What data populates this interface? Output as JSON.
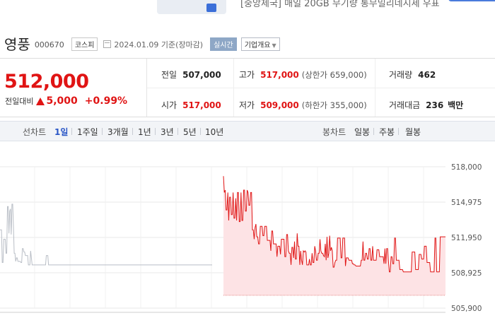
{
  "ad": {
    "text": "[중앙제국] 매일 20GB 무기량 통무밀리네시세 우표"
  },
  "stock": {
    "name": "영풍",
    "code": "000670",
    "market": "코스피",
    "date": "2024.01.09",
    "basis": "기준(장마감)",
    "realtime_label": "실시간",
    "corp_overview_label": "기업개요"
  },
  "price": {
    "current": "512,000",
    "change_label": "전일대비",
    "change_amount": "5,000",
    "change_direction": "up",
    "change_percent": "+0.99%",
    "up_color": "#e01414"
  },
  "stats": {
    "prev_close": {
      "label": "전일",
      "value": "507,000"
    },
    "high": {
      "label": "고가",
      "value": "517,000",
      "limit_label": "상한가",
      "limit_value": "659,000"
    },
    "volume": {
      "label": "거래량",
      "value": "462"
    },
    "open": {
      "label": "시가",
      "value": "517,000"
    },
    "low": {
      "label": "저가",
      "value": "509,000",
      "limit_label": "하한가",
      "limit_value": "355,000"
    },
    "trade_amount": {
      "label": "거래대금",
      "value": "236",
      "unit": "백만"
    }
  },
  "tabs": {
    "line_chart_label": "선차트",
    "periods": [
      "1일",
      "1주일",
      "3개월",
      "1년",
      "3년",
      "5년",
      "10년"
    ],
    "active_period": "1일",
    "candle_chart_label": "봉차트",
    "candle_periods": [
      "일봉",
      "주봉",
      "월봉"
    ]
  },
  "chart_data": {
    "type": "line",
    "title": "",
    "xlabel": "",
    "ylabel": "",
    "ylim": [
      505900,
      518000
    ],
    "y_ticks": [
      "518,000",
      "514,975",
      "511,950",
      "508,925",
      "505,900"
    ],
    "y_tick_values": [
      518000,
      514975,
      511950,
      508925,
      505900
    ],
    "baseline": 507000,
    "grid": true,
    "series": [
      {
        "kind": "previous_day",
        "color": "#b9bec6",
        "values": [
          512600,
          512600,
          512600,
          509800,
          509800,
          511800,
          511800,
          511800,
          510600,
          510600,
          514600,
          514600,
          512300,
          514200,
          514400,
          512200,
          514800,
          514800,
          512900,
          510600,
          510600,
          509900,
          510200,
          510200,
          509900,
          509900,
          509900,
          509900,
          509800,
          509800,
          511000,
          511000,
          510700,
          510700,
          510400,
          510400,
          510400,
          510400,
          509600,
          509600,
          509600,
          510800,
          510200,
          509600,
          509600,
          509600,
          509600,
          509600,
          509600,
          509600,
          509600,
          509600,
          509600,
          509600,
          509600,
          509600,
          509600,
          509600,
          509600,
          509600,
          509600,
          509600,
          510400,
          510400,
          510400,
          509600,
          509600,
          509600,
          509600,
          509600,
          509600,
          509600,
          509600,
          509600,
          509600,
          509600,
          509600,
          509600,
          509600,
          509600,
          509600,
          509600,
          509600,
          509600,
          509600,
          509600,
          509600,
          509600,
          509600,
          509600,
          509600,
          509600,
          509600,
          509600,
          509600,
          509600,
          509600,
          509600,
          509600,
          509600,
          509600,
          509600,
          509600,
          509600,
          509600,
          509600,
          509600,
          509600,
          509600,
          509600,
          509600,
          509600,
          509600,
          509600,
          509600,
          509600,
          509600,
          509600,
          509600,
          509600,
          509600,
          509600,
          509600,
          509600,
          509600,
          509600,
          509600,
          509600,
          509600,
          509600,
          509600,
          509600,
          509600,
          509600,
          509600,
          509600,
          509600,
          509600,
          509600,
          509600,
          509600,
          509600,
          509600,
          509600,
          509600,
          509600,
          509600,
          509600,
          509600,
          509600,
          509600,
          509600,
          509600,
          509600,
          509600,
          509600,
          509600,
          509600,
          509600,
          509600,
          509600,
          509600,
          509600,
          509600,
          509600,
          509600,
          509600,
          509600,
          509600,
          509600,
          509600,
          509600,
          509600,
          509600,
          509600,
          509600,
          509600,
          509600,
          509600,
          509600,
          509600,
          509600,
          509600,
          509600,
          509600,
          509600,
          509600,
          509600,
          509600,
          509600,
          509600,
          509600,
          509600,
          509600,
          509600,
          509600,
          509600,
          509600,
          509600,
          509600,
          509600,
          509600,
          509600,
          509600,
          509600,
          509600,
          509600,
          509600,
          509600,
          509600,
          509600,
          509600,
          509600,
          509600,
          509600,
          509600,
          509600,
          509600,
          509600,
          509600,
          509600,
          509600,
          509600,
          509600,
          509600,
          509600,
          509600,
          509600,
          509600,
          509600,
          509600,
          509600,
          509600,
          509600,
          509600,
          509600,
          509600,
          509600,
          509600,
          509600,
          509600,
          509600,
          509600,
          509600,
          509600,
          509600,
          509600,
          509600,
          509600,
          509600,
          509600,
          509600,
          509600,
          509600,
          509600,
          509600,
          509600,
          509600,
          509600,
          509600,
          509600,
          509600,
          509600,
          509600,
          509600,
          509600,
          509600,
          509600,
          509600,
          509600,
          509600,
          509600,
          509600,
          509600,
          509600,
          509600,
          509600,
          509600,
          509600,
          509600,
          509600,
          509600,
          509600,
          509600,
          509600
        ]
      },
      {
        "kind": "today",
        "color": "#e01414",
        "fill": "#fde3e5",
        "values": [
          517200,
          515800,
          516000,
          514300,
          514300,
          515800,
          513400,
          515400,
          515400,
          513900,
          513900,
          515800,
          513600,
          513600,
          515300,
          513400,
          515800,
          515800,
          513300,
          513300,
          515800,
          513400,
          513400,
          516000,
          516000,
          514200,
          514200,
          516000,
          515800,
          514700,
          514700,
          515800,
          515800,
          512600,
          512600,
          511800,
          512800,
          513100,
          512000,
          512000,
          511400,
          511400,
          512900,
          512900,
          512900,
          512100,
          512100,
          512900,
          512900,
          512900,
          511700,
          511700,
          511700,
          511700,
          510800,
          512500,
          512500,
          511400,
          511400,
          511400,
          511400,
          510300,
          511200,
          511200,
          511200,
          510500,
          511800,
          511800,
          511800,
          511800,
          510300,
          510300,
          512200,
          512200,
          510800,
          510600,
          510600,
          509600,
          511100,
          511100,
          510200,
          511600,
          510100,
          510100,
          512300,
          511200,
          511200,
          509600,
          510800,
          510000,
          509600,
          510800,
          510700,
          510800,
          510700,
          509600,
          509600,
          509600,
          510100,
          509600,
          509600,
          510600,
          509800,
          509800,
          511200,
          510800,
          510000,
          510000,
          510600,
          510600,
          511800,
          510800,
          510600,
          510600,
          510400,
          510300,
          511400,
          510000,
          512000,
          510200,
          510600,
          512100,
          510800,
          511100,
          510800,
          509400,
          509400,
          509800,
          510000,
          510000,
          511900,
          511900,
          511900,
          511900,
          510200,
          510200,
          511900,
          511900,
          511900,
          509500,
          510200,
          510200,
          510200,
          510000,
          510000,
          510000,
          510000,
          509700,
          509700,
          509600,
          509600,
          509500,
          509500,
          509500,
          509500,
          509500,
          509500,
          510000,
          510000,
          511600,
          510000,
          510000,
          510600,
          510600,
          510100,
          510100,
          511000,
          511000,
          510000,
          510000,
          511200,
          510000,
          510000,
          510000,
          510000,
          510900,
          510900,
          510900,
          510300,
          510300,
          510300,
          510300,
          510300,
          509700,
          511000,
          509700,
          511000,
          511000,
          509900,
          509000,
          509000,
          510300,
          510300,
          509700,
          509700,
          511900,
          511900,
          510000,
          510000,
          510000,
          510000,
          509200,
          509200,
          509200,
          509200,
          509000,
          509000,
          509000,
          509000,
          509000,
          509000,
          509000,
          509000,
          509000,
          509000,
          510700,
          510700,
          510700,
          510700,
          509200,
          509200,
          509200,
          509200,
          510500,
          510500,
          510500,
          510100,
          510100,
          510100,
          511200,
          511200,
          511200,
          509800,
          509800,
          509800,
          509800,
          509000,
          509000,
          509000,
          509000,
          509000,
          511900,
          511900,
          509000,
          509000,
          509000,
          509000,
          512000,
          512000,
          512000,
          512000,
          512000,
          512000,
          512000
        ]
      }
    ]
  }
}
